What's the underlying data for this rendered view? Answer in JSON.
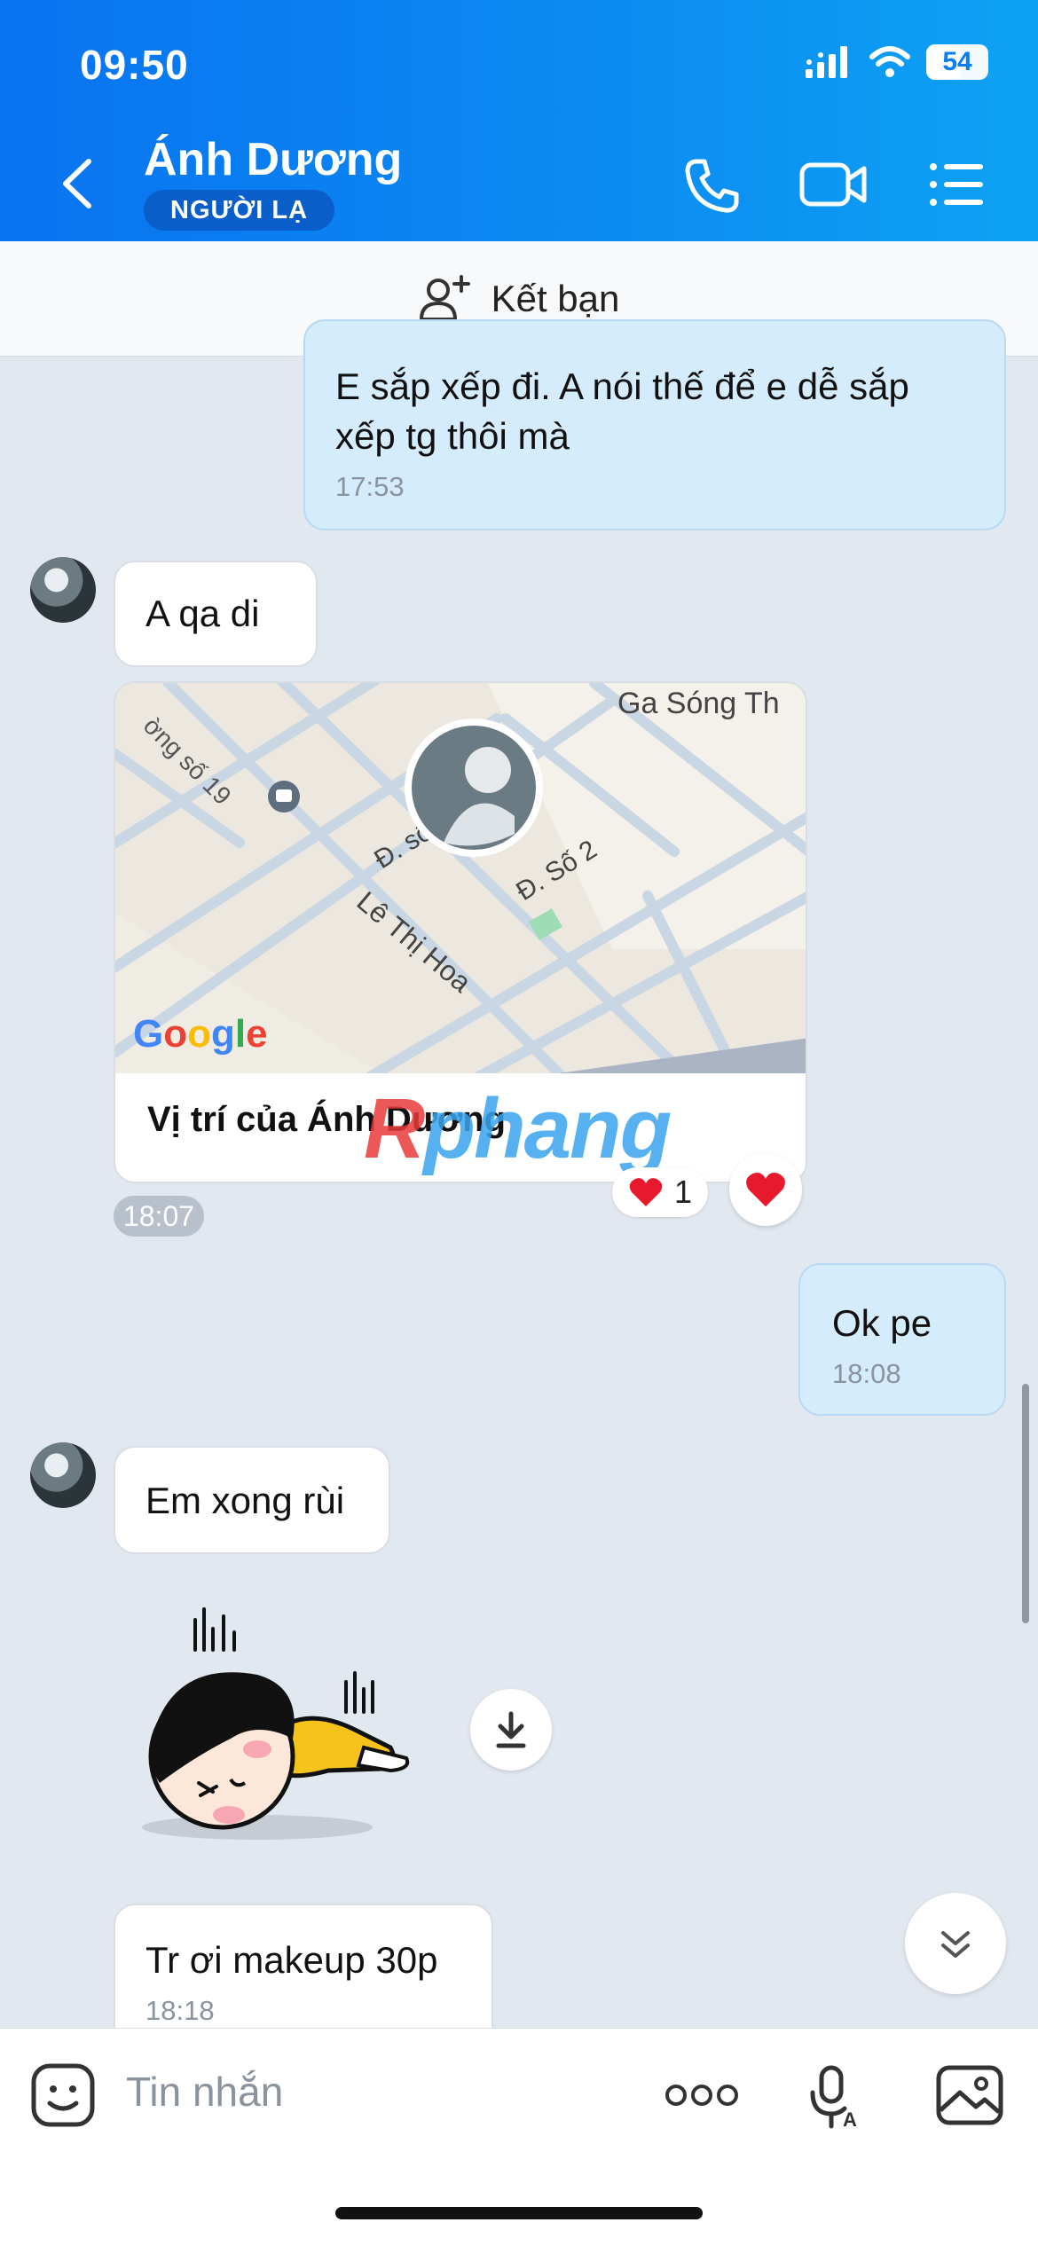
{
  "status_bar": {
    "time": "09:50",
    "battery": "54"
  },
  "header": {
    "contact_name": "Ánh Dương",
    "badge": "NGƯỜI LẠ"
  },
  "add_friend": {
    "label": "Kết bạn"
  },
  "messages": {
    "m1": {
      "text": "E sắp xếp đi. A nói thế để e dễ sắp xếp tg thôi mà",
      "time": "17:53"
    },
    "m2": {
      "text": "A qa di"
    },
    "location": {
      "caption": "Vị trí của Ánh Dương",
      "time": "18:07",
      "reaction_count": "1",
      "map_labels": {
        "station": "Ga Sóng Th",
        "street_19": "ờng số 19",
        "street_4": "Đ. số 4",
        "street_2": "Đ. Số 2",
        "le_thi_hoa": "Lê Thị Hoa",
        "google": "Google"
      }
    },
    "m3": {
      "text": "Ok pe",
      "time": "18:08"
    },
    "m4": {
      "text": "Em xong rùi"
    },
    "m5": {
      "text": "Tr ơi makeup 30p",
      "time": "18:18"
    }
  },
  "watermark": {
    "first": "R",
    "rest": "phang"
  },
  "composer": {
    "placeholder": "Tin nhắn"
  },
  "colors": {
    "header": "#0a7df2",
    "outgoing_bubble": "#d5ecfc",
    "incoming_bubble": "#ffffff",
    "reaction": "#e8192c"
  }
}
